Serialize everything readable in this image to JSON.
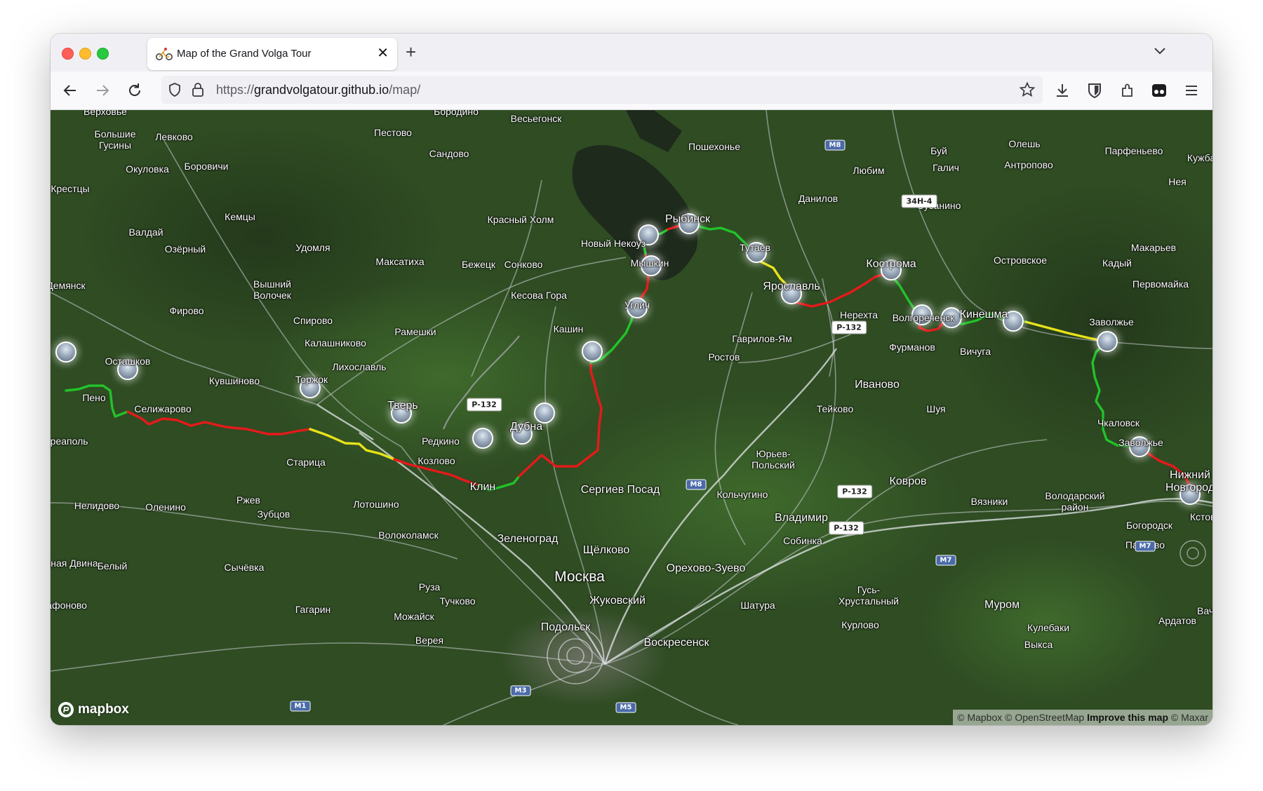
{
  "browser": {
    "tab_title": "Map of the Grand Volga Tour",
    "url_scheme": "https://",
    "url_host": "grandvolgatour.github.io",
    "url_path": "/map/"
  },
  "map": {
    "provider": "mapbox",
    "attribution": {
      "mapbox": "© Mapbox",
      "osm": "© OpenStreetMap",
      "improve": "Improve this map",
      "maxar": "© Maxar"
    },
    "route_colors": {
      "green": "#22c22a",
      "yellow": "#e8e21a",
      "red": "#e51a1a"
    },
    "places": [
      {
        "name": "Верховье"
      },
      {
        "name": "Бородино"
      },
      {
        "name": "Весьегонск"
      },
      {
        "name": "Большие Гусины"
      },
      {
        "name": "Левково"
      },
      {
        "name": "Пестово"
      },
      {
        "name": "Сандово"
      },
      {
        "name": "Пошехонье"
      },
      {
        "name": "Буй"
      },
      {
        "name": "Олешь"
      },
      {
        "name": "Парфеньево"
      },
      {
        "name": "Кужба"
      },
      {
        "name": "Окуловка"
      },
      {
        "name": "Боровичи"
      },
      {
        "name": "Любим"
      },
      {
        "name": "Галич"
      },
      {
        "name": "Антропово"
      },
      {
        "name": "Крестцы"
      },
      {
        "name": "Нея"
      },
      {
        "name": "Данилов"
      },
      {
        "name": "Сусанино"
      },
      {
        "name": "Кемцы"
      },
      {
        "name": "Красный Холм"
      },
      {
        "name": "Рыбинск"
      },
      {
        "name": "Валдай"
      },
      {
        "name": "Новый Некоуз"
      },
      {
        "name": "Тутаев"
      },
      {
        "name": "Макарьев"
      },
      {
        "name": "Озёрный"
      },
      {
        "name": "Удомля"
      },
      {
        "name": "Максатиха"
      },
      {
        "name": "Бежецк"
      },
      {
        "name": "Сонково"
      },
      {
        "name": "Мышкин"
      },
      {
        "name": "Кострома"
      },
      {
        "name": "Островское"
      },
      {
        "name": "Кадый"
      },
      {
        "name": "Демянск"
      },
      {
        "name": "Вышний Волочек"
      },
      {
        "name": "Ярославль"
      },
      {
        "name": "Первомайка"
      },
      {
        "name": "Кесова Гора"
      },
      {
        "name": "Углич"
      },
      {
        "name": "Нерехта"
      },
      {
        "name": "Волгореченск"
      },
      {
        "name": "Кинешма"
      },
      {
        "name": "Фирово"
      },
      {
        "name": "Спирово"
      },
      {
        "name": "Заволжье"
      },
      {
        "name": "Кашин"
      },
      {
        "name": "Гаврилов-Ям"
      },
      {
        "name": "Рамешки"
      },
      {
        "name": "Калашниково"
      },
      {
        "name": "Фурманов"
      },
      {
        "name": "Вичуга"
      },
      {
        "name": "Ростов"
      },
      {
        "name": "Лихославль"
      },
      {
        "name": "Осташков"
      },
      {
        "name": "Кувшиново"
      },
      {
        "name": "Торжок"
      },
      {
        "name": "Иваново"
      },
      {
        "name": "Пено"
      },
      {
        "name": "Тверь"
      },
      {
        "name": "Тейково"
      },
      {
        "name": "Шуя"
      },
      {
        "name": "Селижарово"
      },
      {
        "name": "Дубна"
      },
      {
        "name": "Чкаловск"
      },
      {
        "name": "Андреаполь"
      },
      {
        "name": "Редкино"
      },
      {
        "name": "Заволжье"
      },
      {
        "name": "Козлово"
      },
      {
        "name": "Юрьев-Польский"
      },
      {
        "name": "Старица"
      },
      {
        "name": "Ковров"
      },
      {
        "name": "Нижний Новгород"
      },
      {
        "name": "Клин"
      },
      {
        "name": "Сергиев Посад"
      },
      {
        "name": "Кольчугино"
      },
      {
        "name": "Вязники"
      },
      {
        "name": "Володарский район"
      },
      {
        "name": "Нелидово"
      },
      {
        "name": "Оленино"
      },
      {
        "name": "Ржев"
      },
      {
        "name": "Лотошино"
      },
      {
        "name": "Зубцов"
      },
      {
        "name": "Богородск"
      },
      {
        "name": "Кстово"
      },
      {
        "name": "Владимир"
      },
      {
        "name": "Волоколамск"
      },
      {
        "name": "Зеленоград"
      },
      {
        "name": "Собинка"
      },
      {
        "name": "Павлово"
      },
      {
        "name": "Щёлково"
      },
      {
        "name": "Западная Двина"
      },
      {
        "name": "Белый"
      },
      {
        "name": "Сычёвка"
      },
      {
        "name": "Москва"
      },
      {
        "name": "Орехово-Зуево"
      },
      {
        "name": "Руза"
      },
      {
        "name": "Жуковский"
      },
      {
        "name": "Гусь-Хрустальный"
      },
      {
        "name": "Тучково"
      },
      {
        "name": "Шатура"
      },
      {
        "name": "Муром"
      },
      {
        "name": "Ардатов"
      },
      {
        "name": "Сафоново"
      },
      {
        "name": "Гагарин"
      },
      {
        "name": "Можайск"
      },
      {
        "name": "Подольск"
      },
      {
        "name": "Кулебаки"
      },
      {
        "name": "Курлово"
      },
      {
        "name": "Вача"
      },
      {
        "name": "Верея"
      },
      {
        "name": "Воскресенск"
      },
      {
        "name": "Выкса"
      }
    ],
    "roads": [
      "Р-132",
      "М8",
      "34Н-4",
      "М7",
      "М3",
      "М5",
      "М1"
    ]
  }
}
